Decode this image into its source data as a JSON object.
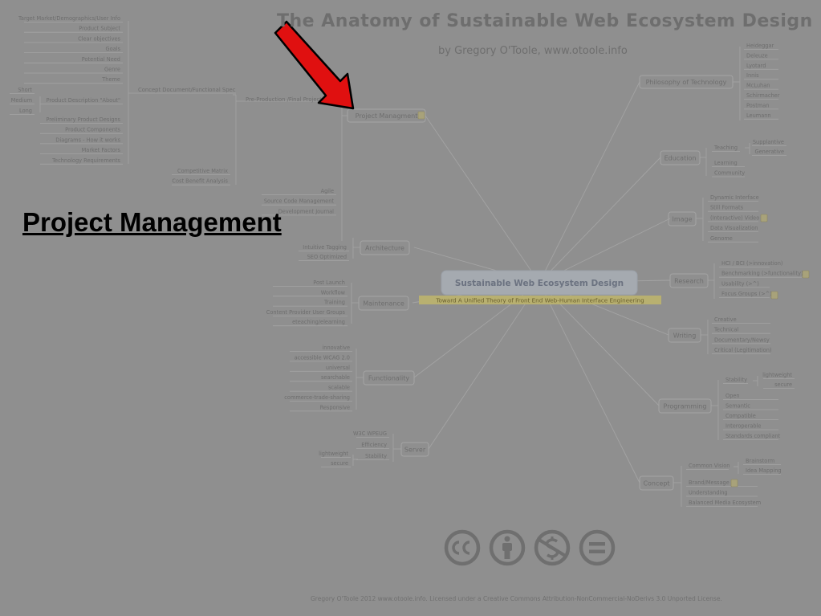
{
  "header": {
    "title": "The Anatomy of Sustainable Web Ecosystem Design",
    "byline": "by Gregory O'Toole, www.otoole.info"
  },
  "overlay": {
    "heading": "Project Management"
  },
  "footer": {
    "license": "Gregory O'Toole 2012 www.otoole.info. Licensed under a Creative Commons Attribution-NonCommercial-NoDerivs 3.0 Unported License."
  },
  "colors": {
    "background": "#8f8f8f",
    "node_border": "#a4a4a4",
    "node_text": "#6e6e6e",
    "arrow": "#e01010",
    "heading": "#000000",
    "center_fill": "#a5aab0",
    "subtitle_fill": "#b8b070"
  },
  "icons": [
    "arrow-pointer-icon",
    "note-icon",
    "cc-icon",
    "attribution-icon",
    "noncommercial-icon",
    "noderivs-icon"
  ],
  "mindmap": {
    "center": "Sustainable Web Ecosystem Design",
    "subtitle": "Toward A Unified Theory of Front End Web-Human Interface Engineering",
    "project_management": {
      "label": "Project Managment",
      "preproduction": "Pre-Production /Final Project Plan",
      "concept_doc": "Concept Document/Functional Spec",
      "concept_doc_items": [
        "Target Market/Demographics/User Info",
        "Product Subject",
        "Clear objectives",
        "Goals",
        "Potential Need",
        "Genre",
        "Theme"
      ],
      "product_description": "Product Description \"About\"",
      "product_description_sizes": [
        "Short",
        "Medium",
        "Long"
      ],
      "concept_doc_items_2": [
        "Preliminary Product Designs",
        "Product Components",
        "Diagrams - How it works",
        "Market Factors",
        "Technology Requirements"
      ],
      "preproduction_items": [
        "Competitive Matrix",
        "Cost Benefit Analysis"
      ],
      "process_items": [
        "Agile",
        "Source Code Management",
        "Development Journal"
      ]
    },
    "architecture": {
      "label": "Architecture",
      "items": [
        "Intuitive Tagging",
        "SEO Optimized"
      ]
    },
    "maintenance": {
      "label": "Maintenance",
      "items": [
        "Post Launch",
        "Workflow",
        "Training",
        "Content Provider User Groups",
        "eteaching/elearning"
      ]
    },
    "functionality": {
      "label": "Functionality",
      "items": [
        "innovative",
        "accessible WCAG 2.0",
        "universal",
        "searchable",
        "scalable",
        "commerce-trade-sharing",
        "Responsive"
      ]
    },
    "server": {
      "label": "Server",
      "items": [
        "W3C WPEUG",
        "Efficiency",
        "Stability"
      ],
      "stability_items": [
        "lightweight",
        "secure"
      ]
    },
    "philosophy": {
      "label": "Philosophy of Technology",
      "items": [
        "Heideggar",
        "Deleuze",
        "Lyotard",
        "Innis",
        "McLuhan",
        "Schirmacher",
        "Postman",
        "Leumann"
      ]
    },
    "education": {
      "label": "Education",
      "teaching": "Teaching",
      "teaching_items": [
        "Supplantive",
        "Generative"
      ],
      "items": [
        "Learning",
        "Community"
      ]
    },
    "image": {
      "label": "Image",
      "items": [
        "Dynamic Interface",
        "Still Formats",
        "(Interactive) Video",
        "Data Visualization",
        "Genome"
      ]
    },
    "research": {
      "label": "Research",
      "items": [
        "HCI / BCI (>innovation)",
        "Benchmarking (>functionality)",
        "Usability (>^)",
        "Focus Groups (>^)"
      ]
    },
    "writing": {
      "label": "Writing",
      "items": [
        "Creative",
        "Technical",
        "Documentary/Newsy",
        "Critical (Legitimation)"
      ]
    },
    "programming": {
      "label": "Programming",
      "stability": "Stability",
      "stability_items": [
        "lightweight",
        "secure"
      ],
      "items": [
        "Open",
        "Semantic",
        "Compatible",
        "Interoperable",
        "Standards compliant"
      ]
    },
    "concept": {
      "label": "Concept",
      "common_vision": "Common Vision",
      "common_vision_items": [
        "Brainstorm",
        "Idea Mapping"
      ],
      "items": [
        "Brand/Message",
        "Understanding",
        "Balanced Media Ecosystem"
      ]
    }
  }
}
